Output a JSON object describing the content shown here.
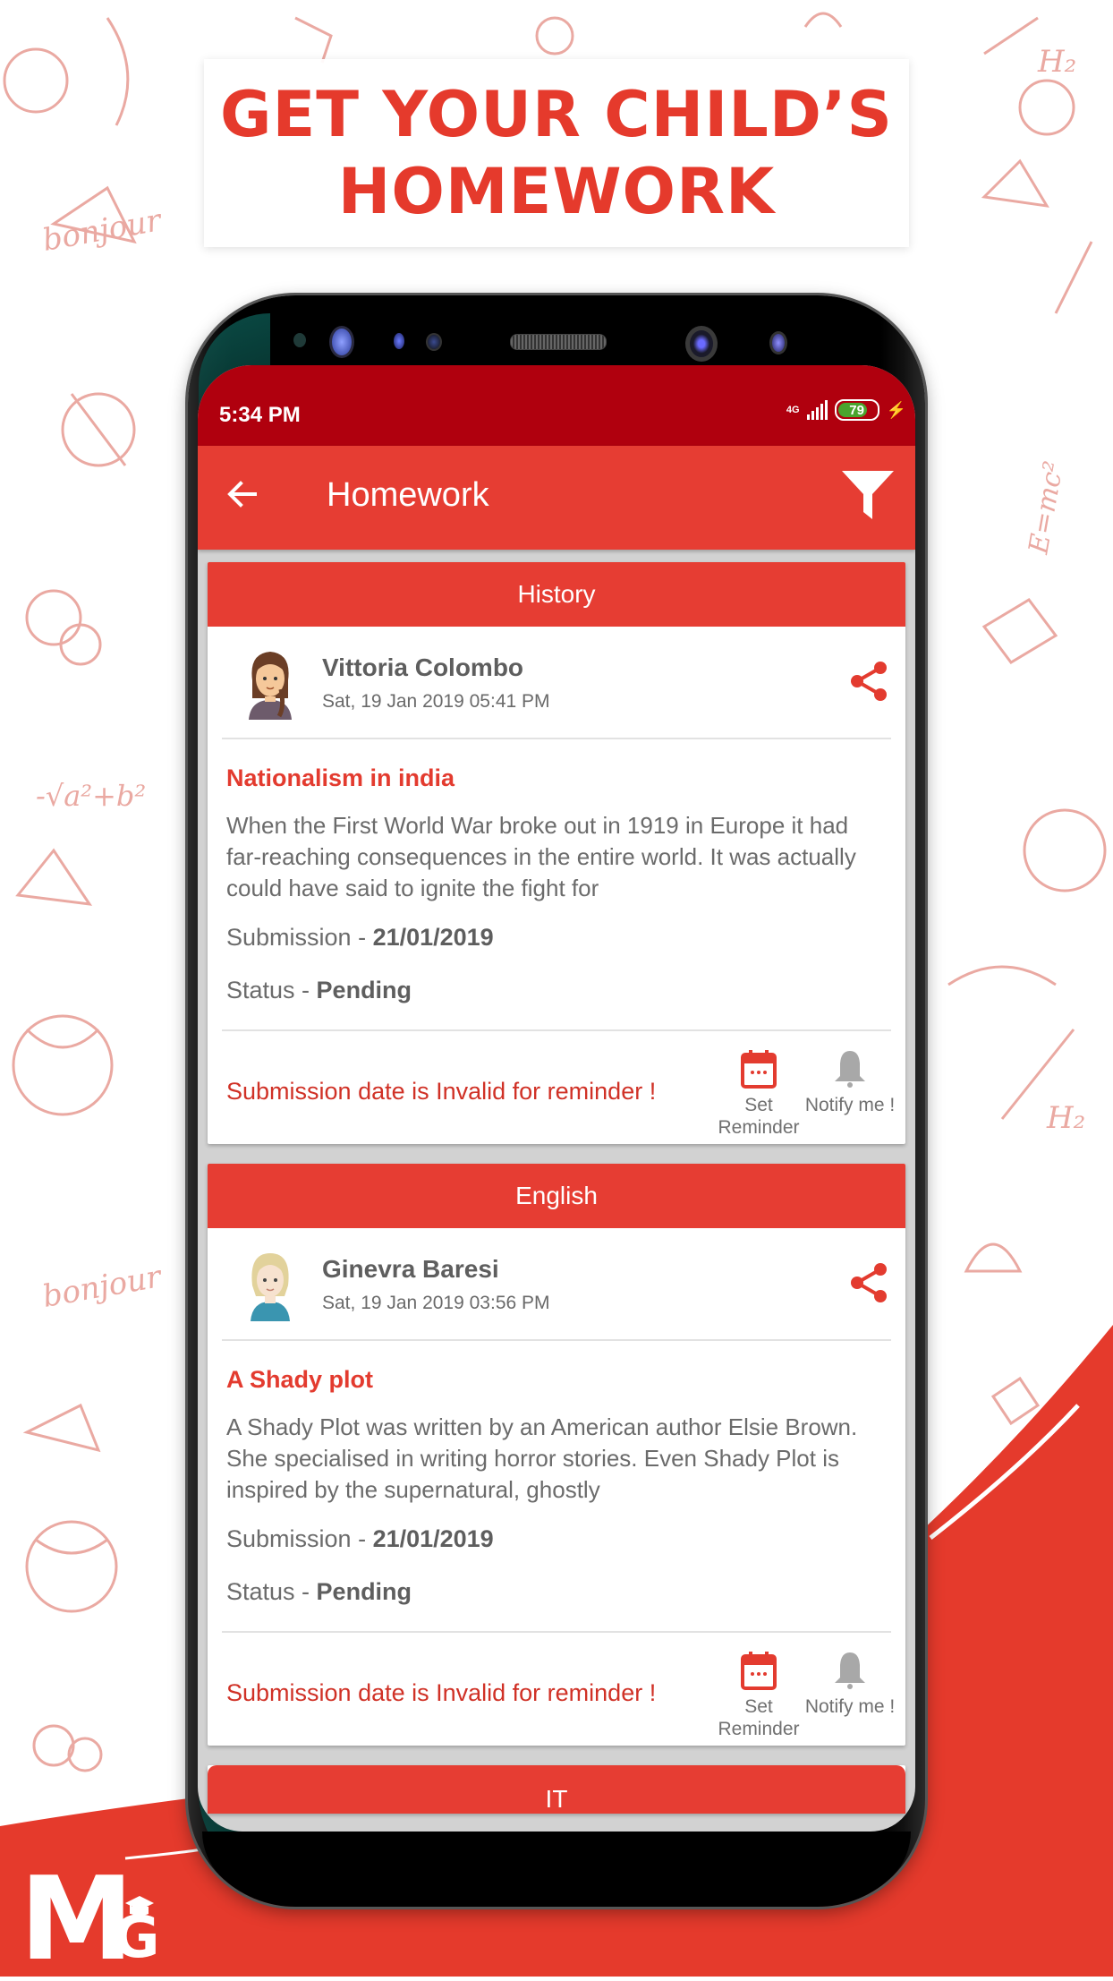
{
  "banner": {
    "line1": "GET YOUR CHILD’S",
    "line2": "HOMEWORK"
  },
  "colors": {
    "brand_red": "#e63d33",
    "status_bar": "#b0000e",
    "headline_red": "#e53a2c",
    "battery_green": "#4aa42e"
  },
  "status_bar": {
    "time": "5:34 PM",
    "network": "4G",
    "battery_percent": 79,
    "battery_label": "79",
    "charging_icon": "bolt-icon"
  },
  "app_bar": {
    "back_icon": "arrow-left-icon",
    "title": "Homework",
    "filter_icon": "filter-icon"
  },
  "homework": [
    {
      "subject": "History",
      "teacher": "Vittoria Colombo",
      "posted": "Sat, 19 Jan 2019 05:41 PM",
      "title": "Nationalism in india",
      "description": "When the First World War broke out in 1919 in Europe it had far-reaching consequences in the entire world. It was actually could have said to ignite the fight for",
      "submission_label": "Submission - ",
      "submission_date": "21/01/2019",
      "status_label": "Status - ",
      "status": "Pending",
      "reminder_message": "Submission date is Invalid for reminder !",
      "set_reminder_label": "Set Reminder",
      "notify_label": "Notify me !"
    },
    {
      "subject": "English",
      "teacher": "Ginevra Baresi",
      "posted": "Sat, 19 Jan 2019 03:56 PM",
      "title": "A Shady plot",
      "description": "A Shady Plot was written by an American author Elsie Brown. She specialised in writing horror stories. Even Shady Plot is inspired by the supernatural, ghostly",
      "submission_label": "Submission - ",
      "submission_date": "21/01/2019",
      "status_label": "Status - ",
      "status": "Pending",
      "reminder_message": "Submission date is Invalid for reminder !",
      "set_reminder_label": "Set Reminder",
      "notify_label": "Notify me !"
    },
    {
      "subject": "IT"
    }
  ],
  "logo": {
    "text_m": "M",
    "text_g": "G",
    "icon": "graduation-cap-icon"
  }
}
